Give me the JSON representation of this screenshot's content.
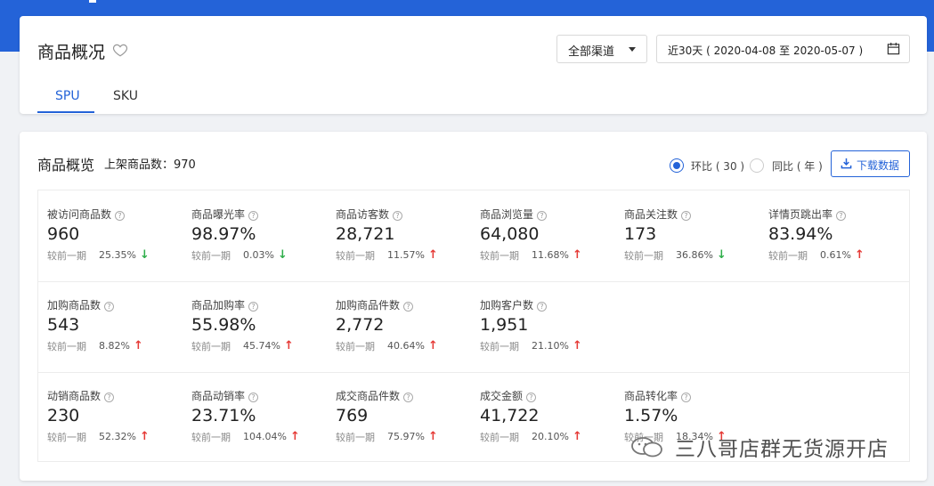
{
  "header": {
    "title": "商品概况",
    "channel_select": "全部渠道",
    "date_range": "近30天 ( 2020-04-08 至 2020-05-07 )"
  },
  "tabs": [
    {
      "label": "SPU",
      "active": true
    },
    {
      "label": "SKU",
      "active": false
    }
  ],
  "overview": {
    "title": "商品概览",
    "subtitle": "上架商品数：970",
    "radio_mom": "环比 ( 30 )",
    "radio_yoy": "同比 ( 年 )",
    "download_label": "下载数据",
    "compare_label": "较前一期"
  },
  "metrics": [
    {
      "label": "被访问商品数",
      "value": "960",
      "pct": "25.35%",
      "trend": "down"
    },
    {
      "label": "商品曝光率",
      "value": "98.97%",
      "pct": "0.03%",
      "trend": "down"
    },
    {
      "label": "商品访客数",
      "value": "28,721",
      "pct": "11.57%",
      "trend": "up"
    },
    {
      "label": "商品浏览量",
      "value": "64,080",
      "pct": "11.68%",
      "trend": "up"
    },
    {
      "label": "商品关注数",
      "value": "173",
      "pct": "36.86%",
      "trend": "down"
    },
    {
      "label": "详情页跳出率",
      "value": "83.94%",
      "pct": "0.61%",
      "trend": "up"
    },
    {
      "label": "加购商品数",
      "value": "543",
      "pct": "8.82%",
      "trend": "up"
    },
    {
      "label": "商品加购率",
      "value": "55.98%",
      "pct": "45.74%",
      "trend": "up"
    },
    {
      "label": "加购商品件数",
      "value": "2,772",
      "pct": "40.64%",
      "trend": "up"
    },
    {
      "label": "加购客户数",
      "value": "1,951",
      "pct": "21.10%",
      "trend": "up"
    },
    {
      "label": "动销商品数",
      "value": "230",
      "pct": "52.32%",
      "trend": "up"
    },
    {
      "label": "商品动销率",
      "value": "23.71%",
      "pct": "104.04%",
      "trend": "up"
    },
    {
      "label": "成交商品件数",
      "value": "769",
      "pct": "75.97%",
      "trend": "up"
    },
    {
      "label": "成交金额",
      "value": "41,722",
      "pct": "20.10%",
      "trend": "up"
    },
    {
      "label": "商品转化率",
      "value": "1.57%",
      "pct": "18.34%",
      "trend": "up"
    }
  ],
  "watermark": "三八哥店群无货源开店",
  "colors": {
    "accent": "#2463d8",
    "up": "#e53935",
    "down": "#2eae4a"
  }
}
